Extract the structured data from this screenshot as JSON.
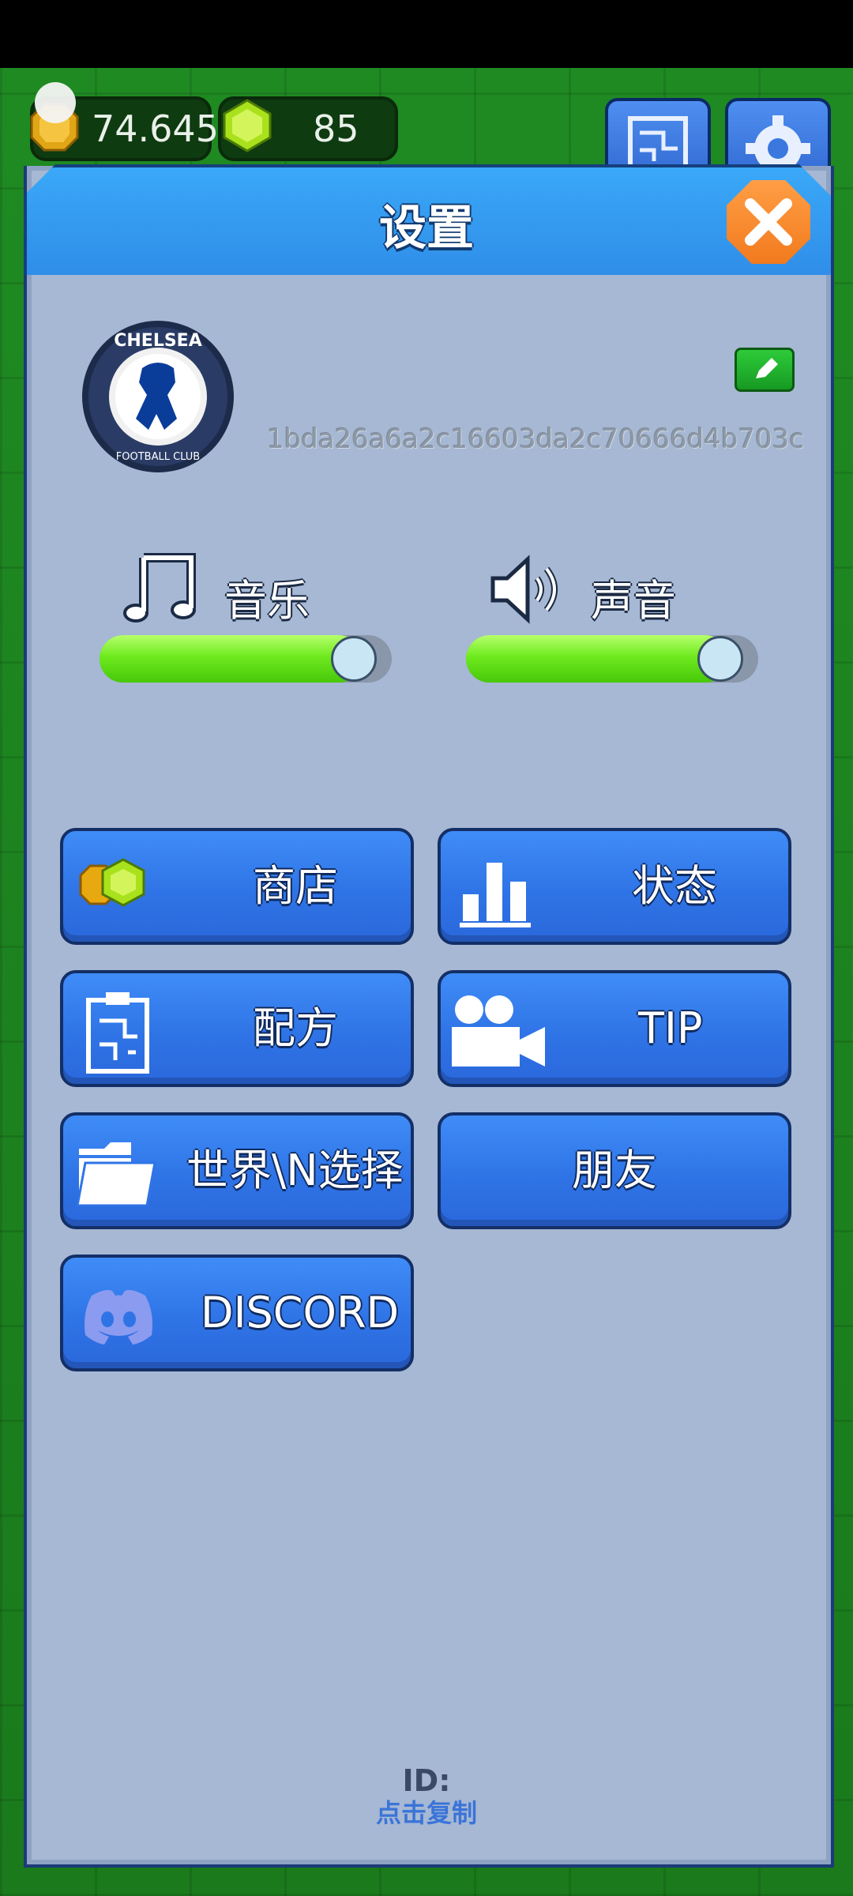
{
  "currency": {
    "coins": "74.645",
    "gems": "85"
  },
  "top_buttons": {
    "recipe_icon": "circuit-board-icon",
    "settings_icon": "gear-icon"
  },
  "dialog": {
    "title": "设置",
    "close_icon": "close-icon"
  },
  "profile": {
    "avatar": "chelsea-fc-badge",
    "user_hash": "1bda26a6a2c16603da2c70666d4b703c",
    "edit_icon": "pencil-icon"
  },
  "audio": {
    "music_label": "音乐",
    "music_level": 0.9,
    "sound_label": "声音",
    "sound_level": 0.9
  },
  "menu": {
    "shop": "商店",
    "stats": "状态",
    "recipe": "配方",
    "tip": "TIP",
    "world_select": "世界\\N选择",
    "friends": "朋友",
    "discord": "DISCORD"
  },
  "footer": {
    "id_label": "ID:",
    "copy_hint": "点击复制"
  },
  "colors": {
    "panel": "#a6b8d3",
    "header": "#2f8de8",
    "button": "#2f74e6",
    "slider_fill": "#6eea1e",
    "close": "#f27a1d"
  }
}
